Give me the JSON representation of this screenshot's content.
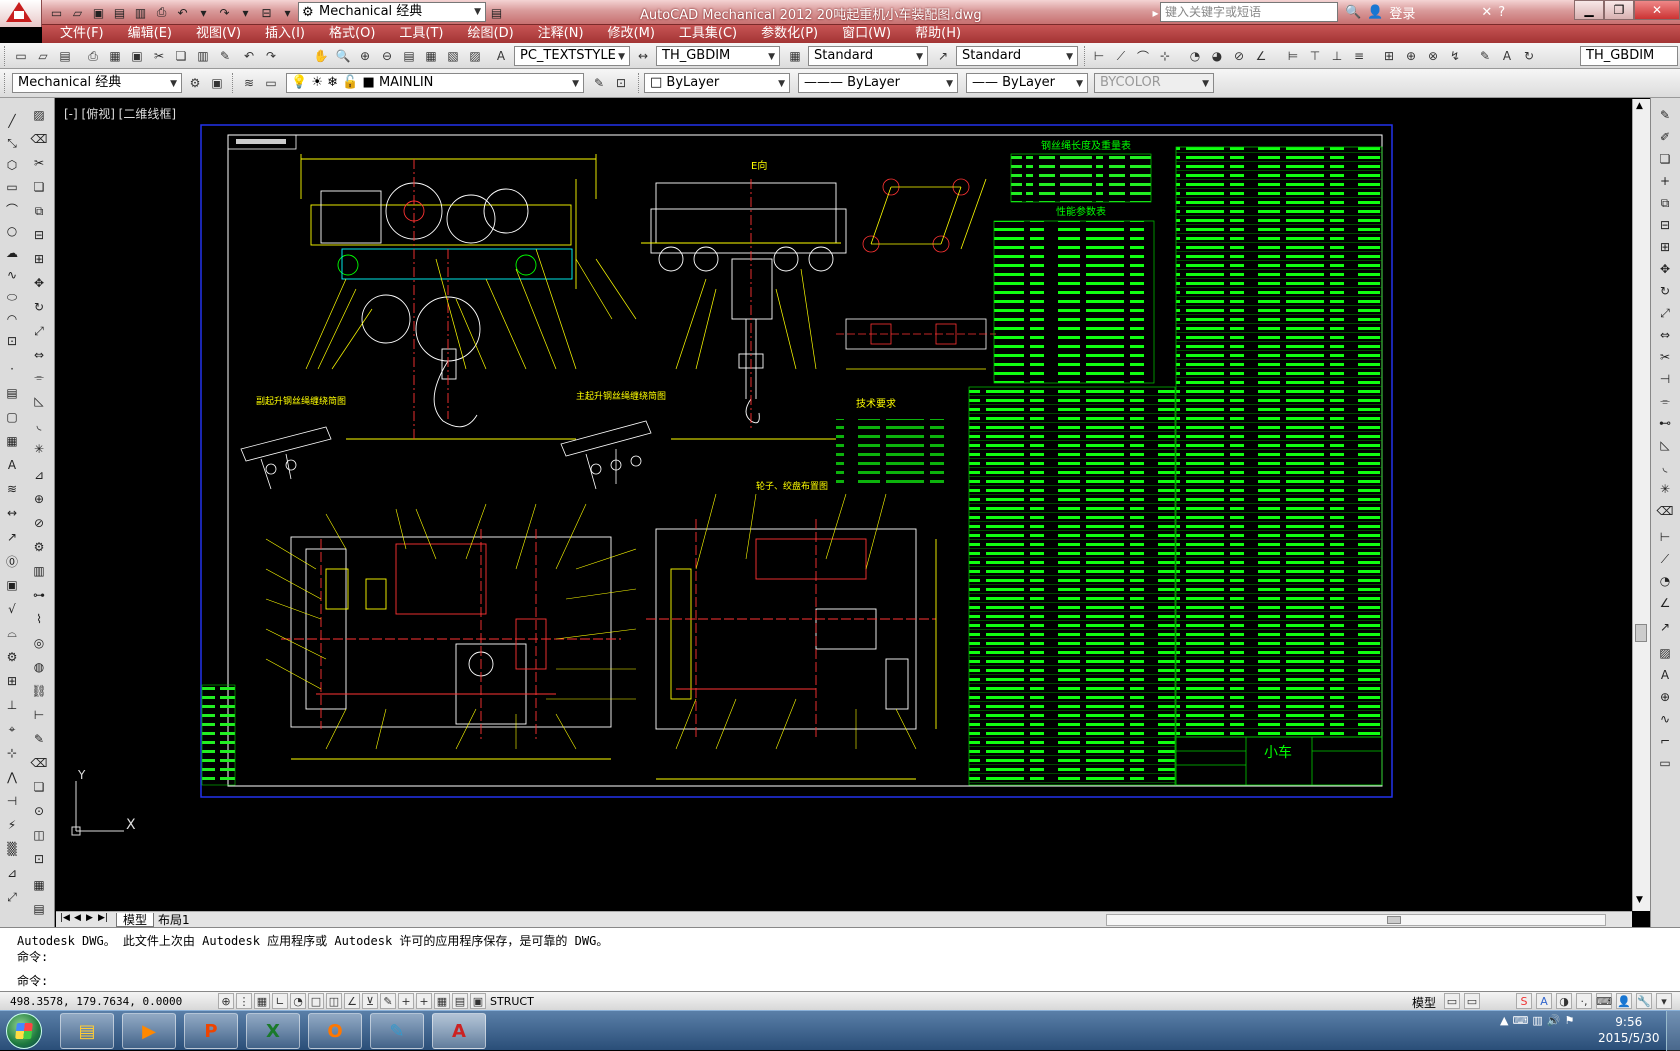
{
  "title_bar": {
    "workspace": "Mechanical 经典",
    "title": "AutoCAD Mechanical 2012    20吨起重机小车装配图.dwg",
    "search_placeholder": "键入关键字或短语",
    "login": "登录",
    "help": "?"
  },
  "menu": [
    "文件(F)",
    "编辑(E)",
    "视图(V)",
    "插入(I)",
    "格式(O)",
    "工具(T)",
    "绘图(D)",
    "注释(N)",
    "修改(M)",
    "工具集(C)",
    "参数化(P)",
    "窗口(W)",
    "帮助(H)"
  ],
  "toolbar1": {
    "text_style": "PC_TEXTSTYLE",
    "dim_style": "TH_GBDIM",
    "table_style": "Standard",
    "multileader_style": "Standard",
    "right_dim_style": "TH_GBDIM"
  },
  "toolbar2": {
    "workspace": "Mechanical 经典",
    "layer": "MAINLIN",
    "color": "ByLayer",
    "linetype": "ByLayer",
    "lineweight": "ByLayer",
    "plotstyle": "BYCOLOR"
  },
  "canvas": {
    "viewport_label": "[-] [俯视] [二维线框]",
    "ucs_x": "X",
    "ucs_y": "Y",
    "title_top_view": "E向",
    "text_tech_req": "技术要求",
    "text_sub1": "副起升钢丝绳缠绕简图",
    "text_sub2": "主起升钢丝绳缠绕简图",
    "text_sub3": "轮子、绞盘布置图",
    "text_table1": "钢丝绳长度及重量表",
    "text_table2": "性能参数表",
    "title_block_name": "小车"
  },
  "layout_tabs": [
    "模型",
    "布局1"
  ],
  "command_line": {
    "line1": "Autodesk DWG。  此文件上次由 Autodesk 应用程序或 Autodesk 许可的应用程序保存，是可靠的 DWG。",
    "line2": "命令:",
    "line3": "命令:"
  },
  "status_bar": {
    "coords": "498.3578,  179.7634, 0.0000",
    "struct_label": "STRUCT",
    "model_label": "模型"
  },
  "taskbar": {
    "time": "9:56",
    "date": "2015/5/30"
  }
}
